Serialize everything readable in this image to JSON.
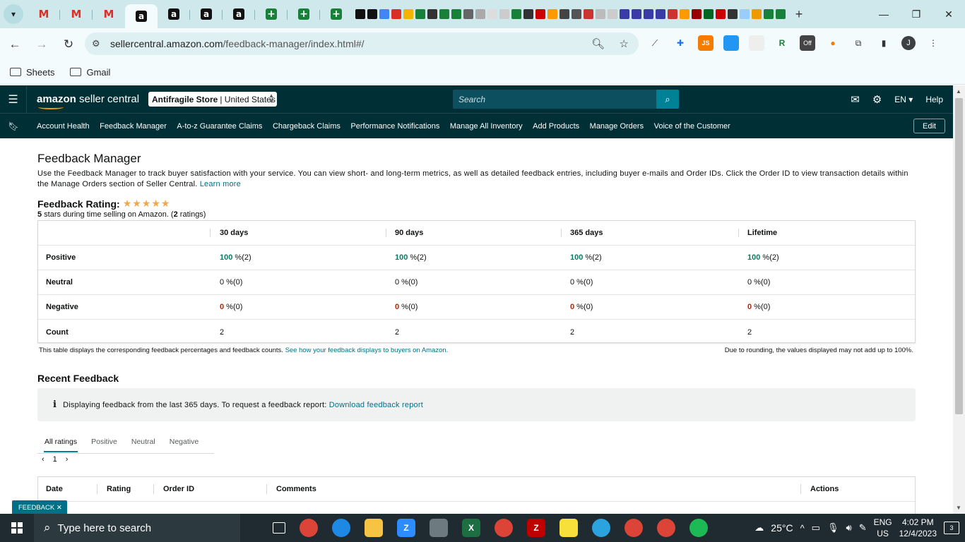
{
  "browser": {
    "tab_icons": [
      "gmail",
      "gmail",
      "gmail",
      "amazon",
      "amazon",
      "amazon",
      "amazon",
      "sheets-plus",
      "sheets-plus",
      "sheets-plus"
    ],
    "new_tab": "+",
    "url_host": "sellercentral.amazon.com",
    "url_path": "/feedback-manager/index.html#/",
    "bookmarks": [
      "Sheets",
      "Gmail"
    ],
    "profile_initial": "J",
    "ext_off_label": "Off",
    "ext_js_label": "JS"
  },
  "header": {
    "logo_text_bold": "amazon",
    "logo_text": " seller central",
    "store_name": "Antifragile Store",
    "store_region": "| United States",
    "search_placeholder": "Search",
    "language": "EN",
    "help": "Help"
  },
  "nav": {
    "items": [
      "Account Health",
      "Feedback Manager",
      "A-to-z Guarantee Claims",
      "Chargeback Claims",
      "Performance Notifications",
      "Manage All Inventory",
      "Add Products",
      "Manage Orders",
      "Voice of the Customer"
    ],
    "edit_label": "Edit"
  },
  "page": {
    "title": "Feedback Manager",
    "intro": "Use the Feedback Manager to track buyer satisfaction with your service. You can view short- and long-term metrics, as well as detailed feedback entries, including buyer e-mails and Order IDs. Click the Order ID to view transaction details within the Manage Orders section of Seller Central.",
    "learn_more": "Learn more",
    "rating_label": "Feedback Rating:",
    "stars": "★★★★★",
    "rating_stars_value": "5",
    "rating_sub_mid": " stars during time selling on Amazon. (",
    "rating_count": "2",
    "rating_sub_end": " ratings)"
  },
  "metrics": {
    "columns": [
      "30 days",
      "90 days",
      "365 days",
      "Lifetime"
    ],
    "rows": [
      {
        "label": "Positive",
        "cells": [
          {
            "pct": "100",
            "rest": " %(2)"
          },
          {
            "pct": "100",
            "rest": " %(2)"
          },
          {
            "pct": "100",
            "rest": " %(2)"
          },
          {
            "pct": "100",
            "rest": " %(2)"
          }
        ]
      },
      {
        "label": "Neutral",
        "cells": [
          {
            "pct": "0",
            "rest": " %(0)"
          },
          {
            "pct": "0",
            "rest": " %(0)"
          },
          {
            "pct": "0",
            "rest": " %(0)"
          },
          {
            "pct": "0",
            "rest": " %(0)"
          }
        ]
      },
      {
        "label": "Negative",
        "cells": [
          {
            "pct": "0",
            "rest": " %(0)"
          },
          {
            "pct": "0",
            "rest": " %(0)"
          },
          {
            "pct": "0",
            "rest": " %(0)"
          },
          {
            "pct": "0",
            "rest": " %(0)"
          }
        ]
      },
      {
        "label": "Count",
        "cells": [
          {
            "pct": "",
            "rest": "2"
          },
          {
            "pct": "",
            "rest": "2"
          },
          {
            "pct": "",
            "rest": "2"
          },
          {
            "pct": "",
            "rest": "2"
          }
        ]
      }
    ],
    "footnote": "This table displays the corresponding feedback percentages and feedback counts.",
    "footnote_link": "See how your feedback displays to buyers on Amazon.",
    "rounding_note": "Due to rounding, the values displayed may not add up to 100%."
  },
  "recent": {
    "title": "Recent Feedback",
    "info_text": "Displaying feedback from the last 365 days. To request a feedback report:",
    "info_link": "Download feedback report",
    "tabs": [
      "All ratings",
      "Positive",
      "Neutral",
      "Negative"
    ],
    "page_number": "1",
    "columns": [
      "Date",
      "Rating",
      "Order ID",
      "Comments",
      "Actions"
    ]
  },
  "feedback_badge": "FEEDBACK",
  "taskbar": {
    "search_placeholder": "Type here to search",
    "temperature": "25°C",
    "lang_top": "ENG",
    "lang_bottom": "US",
    "time": "4:02 PM",
    "date": "12/4/2023",
    "notifications": "3"
  },
  "colors": {
    "header_bg": "#002f36",
    "link": "#007185",
    "positive": "#067d62",
    "negative": "#b12704",
    "star": "#f3a847"
  }
}
